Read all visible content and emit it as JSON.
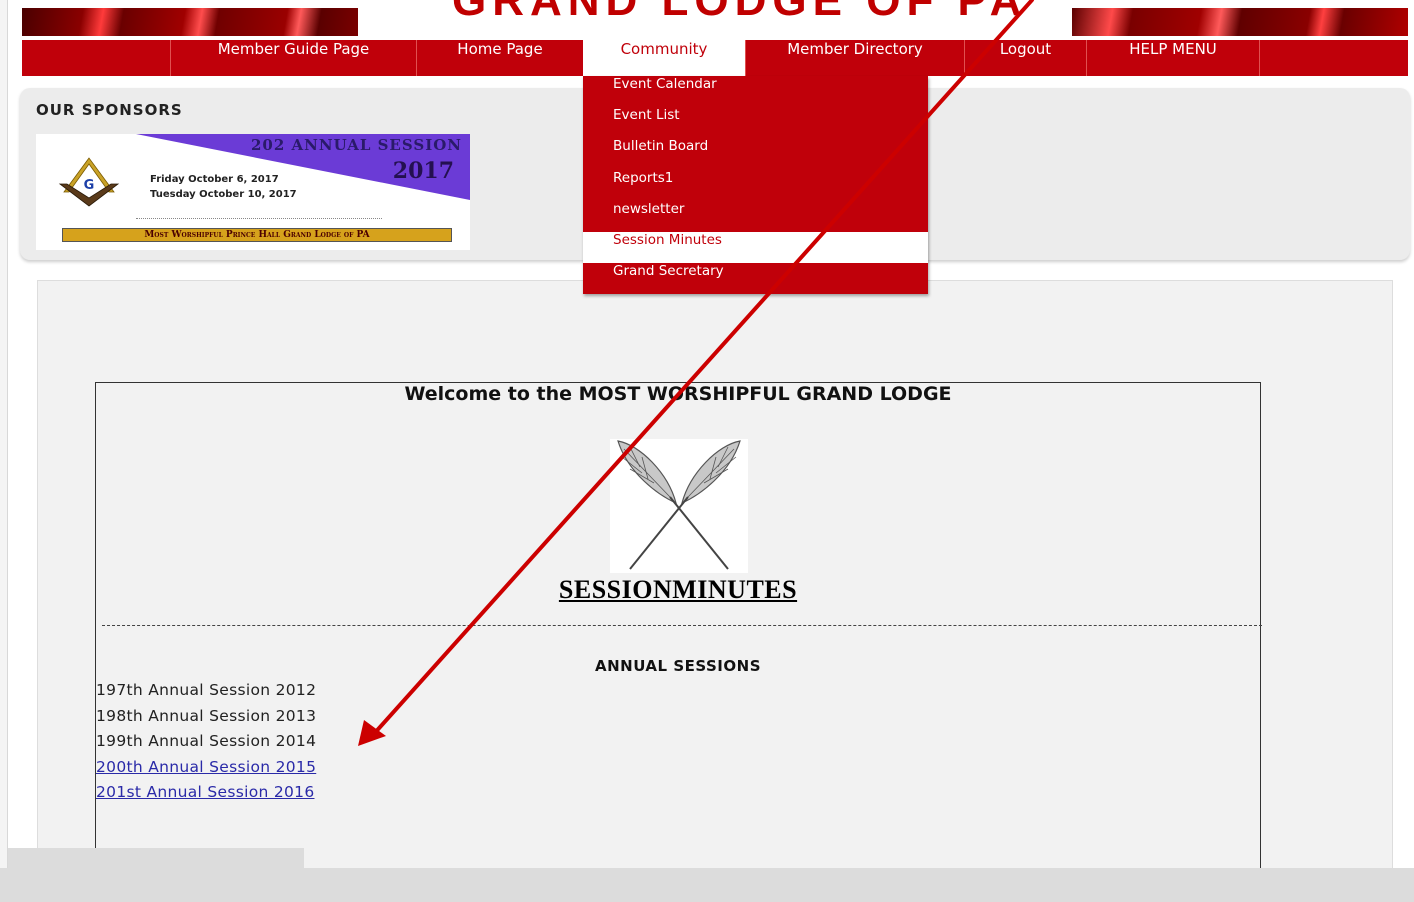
{
  "header": {
    "banner_title": "GRAND LODGE OF PA"
  },
  "nav": {
    "items": [
      {
        "label": "Member Guide Page"
      },
      {
        "label": "Home Page"
      },
      {
        "label": "Community"
      },
      {
        "label": "Member Directory"
      },
      {
        "label": "Logout"
      },
      {
        "label": "HELP MENU"
      }
    ],
    "active_item": "Community"
  },
  "dropdown": {
    "items": [
      {
        "label": "Event Calendar"
      },
      {
        "label": "Event List"
      },
      {
        "label": "Bulletin Board"
      },
      {
        "label": "Reports1"
      },
      {
        "label": "newsletter"
      },
      {
        "label": "Session Minutes"
      },
      {
        "label": "Grand Secretary"
      }
    ],
    "highlighted_item": "Session Minutes"
  },
  "sponsors": {
    "heading": "OUR SPONSORS",
    "ad": {
      "title": "202 ANNUAL SESSION",
      "year": "2017",
      "date_line_1": "Friday October 6, 2017",
      "date_line_2": "Tuesday October 10, 2017",
      "footer": "Most Worshipful Prince Hall Grand Lodge of PA",
      "logo_letter": "G"
    }
  },
  "main": {
    "welcome_title": "Welcome to the MOST WORSHIPFUL GRAND LODGE",
    "session_heading": "SESSIONMINUTES",
    "annual_heading": "ANNUAL SESSIONS",
    "sessions": [
      {
        "label": "197th Annual Session 2012",
        "is_link": false
      },
      {
        "label": "198th Annual Session 2013",
        "is_link": false
      },
      {
        "label": "199th Annual Session 2014",
        "is_link": false
      },
      {
        "label": "200th Annual Session 2015",
        "is_link": true
      },
      {
        "label": "201st Annual Session 2016",
        "is_link": true
      }
    ]
  },
  "colors": {
    "brand_red": "#c0000a",
    "link_blue": "#2a2aa8",
    "annotation_red": "#cc0000"
  }
}
